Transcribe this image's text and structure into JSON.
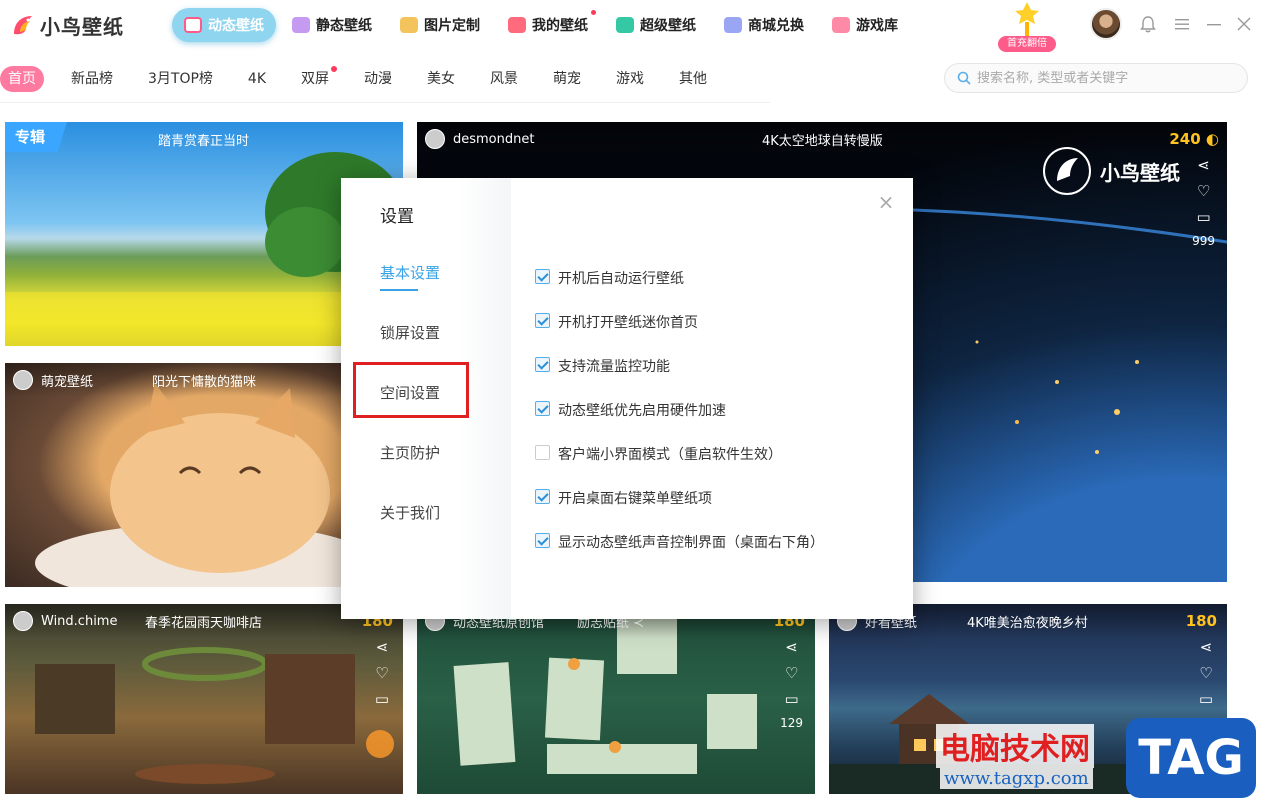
{
  "app": {
    "logo_text": "小鸟壁纸"
  },
  "nav": [
    {
      "label": "动态壁纸",
      "icon": "play-icon",
      "color": "#ff5b8a",
      "active": true
    },
    {
      "label": "静态壁纸",
      "icon": "image-icon",
      "color": "#c49bf0"
    },
    {
      "label": "图片定制",
      "icon": "diy-icon",
      "color": "#f4c45c"
    },
    {
      "label": "我的壁纸",
      "icon": "user-icon",
      "color": "#ff6b7d",
      "dot": true
    },
    {
      "label": "超级壁纸",
      "icon": "star-icon",
      "color": "#34c9a4"
    },
    {
      "label": "商城兑换",
      "icon": "shop-icon",
      "color": "#9aa6f4"
    },
    {
      "label": "游戏库",
      "icon": "gamepad-icon",
      "color": "#ff8aa8"
    }
  ],
  "promo": {
    "badge": "首充翻倍"
  },
  "window": {
    "bell": "🔔",
    "menu": "≡",
    "minimize": "—",
    "close": "✕"
  },
  "categories": [
    "首页",
    "新品榜",
    "3月TOP榜",
    "4K",
    "双屏",
    "动漫",
    "美女",
    "风景",
    "萌宠",
    "游戏",
    "其他"
  ],
  "search": {
    "placeholder": "搜索名称, 类型或者关键字"
  },
  "cards": {
    "spring": {
      "tag": "专辑",
      "title": "踏青赏春正当时"
    },
    "space": {
      "author": "desmondnet",
      "title": "4K太空地球自转慢版",
      "price": "240",
      "brand": "小鸟壁纸",
      "count": "999"
    },
    "cat": {
      "author": "萌宠壁纸",
      "title": "阳光下慵散的猫咪"
    },
    "cafe": {
      "author": "Wind.chime",
      "title": "春季花园雨天咖啡店",
      "price": "180"
    },
    "green": {
      "author": "动态壁纸原创馆",
      "title": "励志贴纸 ≺",
      "price": "180",
      "count": "129"
    },
    "night": {
      "author": "好看壁纸",
      "title": "4K唯美治愈夜晚乡村",
      "price": "180"
    }
  },
  "settings": {
    "title": "设置",
    "menu": [
      "基本设置",
      "锁屏设置",
      "空间设置",
      "主页防护",
      "关于我们"
    ],
    "options": [
      {
        "label": "开机后自动运行壁纸",
        "checked": true
      },
      {
        "label": "开机打开壁纸迷你首页",
        "checked": true
      },
      {
        "label": "支持流量监控功能",
        "checked": true
      },
      {
        "label": "动态壁纸优先启用硬件加速",
        "checked": true
      },
      {
        "label": "客户端小界面模式（重启软件生效）",
        "checked": false
      },
      {
        "label": "开启桌面右键菜单壁纸项",
        "checked": true
      },
      {
        "label": "显示动态壁纸声音控制界面（桌面右下角）",
        "checked": true
      }
    ],
    "close": "×"
  },
  "watermark": {
    "text": "电脑技术网",
    "url": "www.tagxp.com",
    "tag": "TAG"
  }
}
